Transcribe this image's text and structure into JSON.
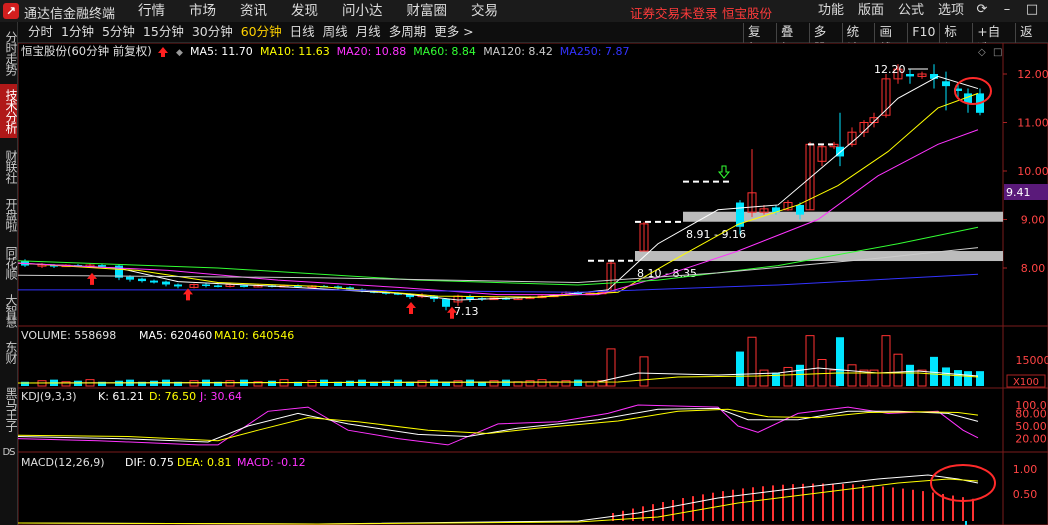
{
  "titlebar": {
    "app_name": "通达信金融终端",
    "menu": [
      "行情",
      "市场",
      "资讯",
      "发现",
      "问小达",
      "财富圈",
      "交易"
    ],
    "notice": "证券交易未登录",
    "stock": "恒宝股份",
    "right_menu": [
      "功能",
      "版面",
      "公式",
      "选项"
    ]
  },
  "leftnav": [
    "分时走势",
    "技术分析",
    "财联社",
    "开盘啦",
    "同花顺",
    "大智慧",
    "东财",
    "黑马王子",
    "DS"
  ],
  "leftnav_active": 1,
  "toolbar": {
    "periods": [
      "分时",
      "1分钟",
      "5分钟",
      "15分钟",
      "30分钟",
      "60分钟",
      "日线",
      "周线",
      "月线",
      "多周期",
      "更多 >"
    ],
    "selected_period": "60分钟",
    "right": [
      "复权",
      "叠加",
      "多股",
      "统计",
      "画线",
      "F10",
      "标记",
      "+自选",
      "返回"
    ]
  },
  "main_panel": {
    "title": "恒宝股份(60分钟 前复权)",
    "ma": [
      {
        "label": "MA5: 11.70",
        "color": "#ffffff"
      },
      {
        "label": "MA10: 11.63",
        "color": "#ffff00"
      },
      {
        "label": "MA20: 10.88",
        "color": "#ff33ff"
      },
      {
        "label": "MA60: 8.84",
        "color": "#33ff33"
      },
      {
        "label": "MA120: 8.42",
        "color": "#cccccc"
      },
      {
        "label": "MA250: 7.87",
        "color": "#3333ff"
      }
    ],
    "price_axis": [
      "12.00",
      "11.00",
      "10.00",
      "9.00",
      "8.00"
    ],
    "current_price": "9.41",
    "annotations": {
      "high": "12.20",
      "low": "7.13",
      "band1": "8.91 - 9.16",
      "band2": "8.10 - 8.35"
    }
  },
  "volume_panel": {
    "label": "VOLUME: 558698",
    "ma5": "MA5: 620460",
    "ma10": "MA10: 640546",
    "axis": "15000",
    "unit": "X100"
  },
  "kdj_panel": {
    "label": "KDJ(9,3,3)",
    "k": "K: 61.21",
    "d": "D: 76.50",
    "j": "J: 30.64",
    "axis": [
      "100.0",
      "80.00",
      "50.00",
      "20.00"
    ]
  },
  "macd_panel": {
    "label": "MACD(12,26,9)",
    "dif": "DIF: 0.75",
    "dea": "DEA: 0.81",
    "macd": "MACD: -0.12",
    "axis": [
      "1.00",
      "0.50"
    ]
  },
  "colors": {
    "up": "#ff3232",
    "down": "#00e5ff",
    "accent": "#ffd200"
  }
}
